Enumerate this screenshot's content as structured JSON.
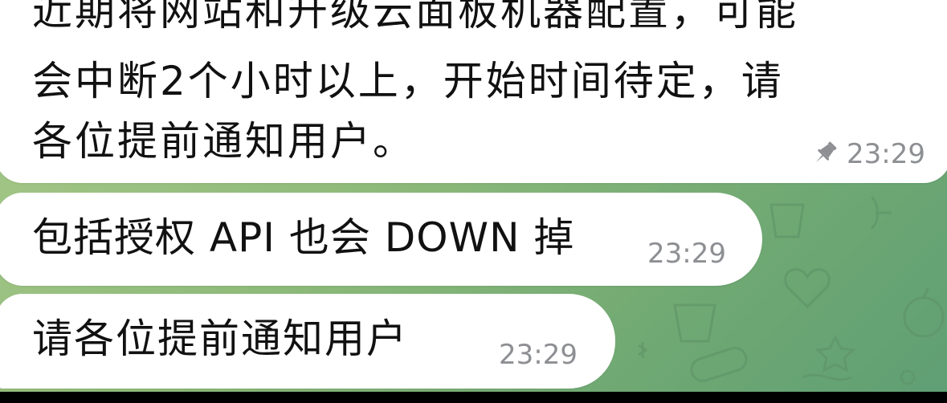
{
  "messages": [
    {
      "lines": [
        "近期将网站和升级云面板机器配置，可能",
        "会中断2个小时以上，开始时间待定，请",
        "各位提前通知用户。"
      ],
      "time": "23:29",
      "pinned": true
    },
    {
      "text": "包括授权 API 也会 DOWN 掉",
      "time": "23:29"
    },
    {
      "text": "请各位提前通知用户",
      "time": "23:29"
    }
  ],
  "icons": {
    "pin": "pin-icon"
  },
  "colors": {
    "bubble": "#ffffff",
    "timestamp": "#8d8f93",
    "wallpaper": "#6fa873",
    "text": "#111111"
  }
}
